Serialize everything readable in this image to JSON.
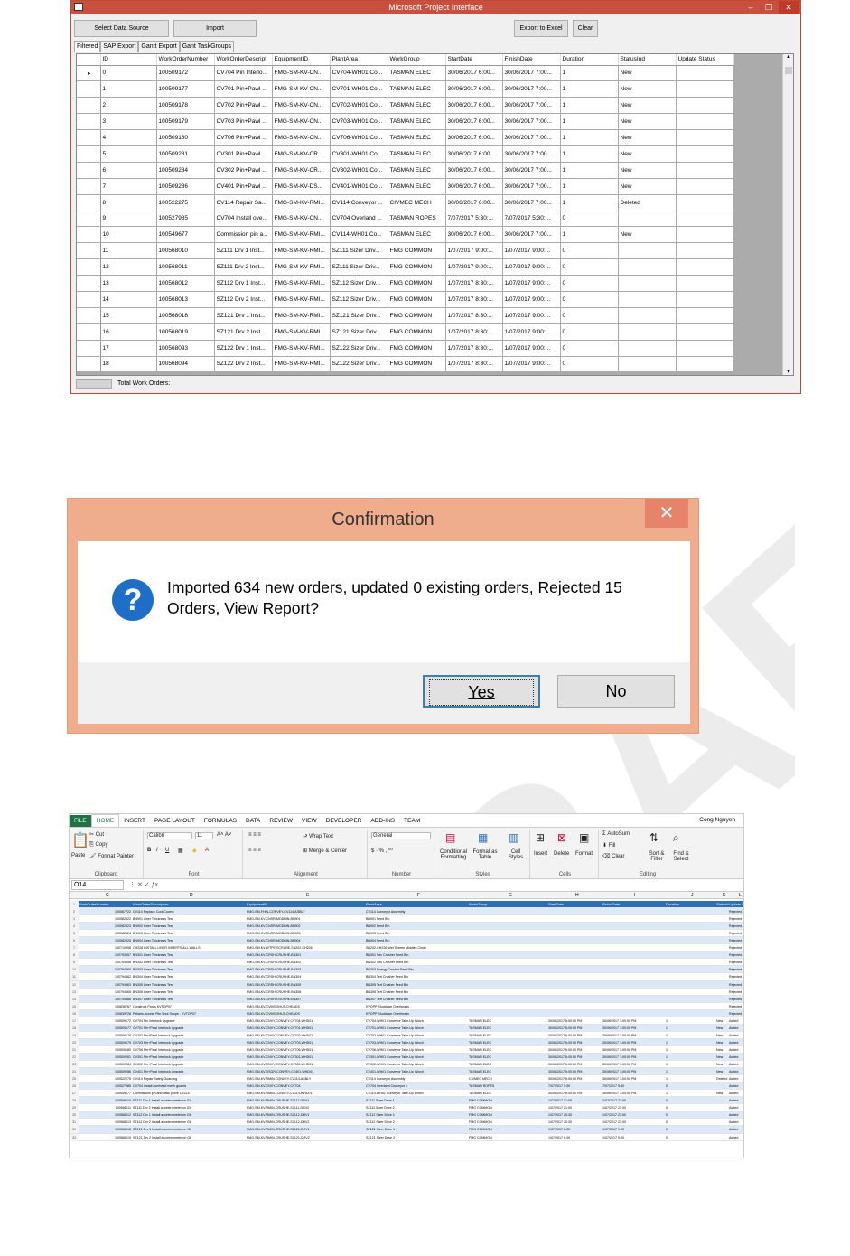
{
  "app_window": {
    "title": "Microsoft Project Interface",
    "buttons": {
      "select": "Select Data Source",
      "import": "Import",
      "export": "Export to Excel",
      "clear": "Clear"
    },
    "tabs": [
      "Filtered",
      "SAP Export",
      "Gantt Export",
      "Gant TaskGroups"
    ],
    "columns": [
      "ID",
      "WorkOrderNumber",
      "WorkOrderDescript",
      "EquipmentID",
      "PlantArea",
      "WorkGroup",
      "StartDate",
      "FinishDate",
      "Duration",
      "StatusInd",
      "Update Status"
    ],
    "rows": [
      [
        "0",
        "100509172",
        "CV704 Pin Interlo...",
        "FMG-SM-KV-CN...",
        "CV704-WH01 Co...",
        "TASMAN ELEC",
        "30/06/2017 6:00...",
        "30/06/2017 7:00...",
        "1",
        "New",
        ""
      ],
      [
        "1",
        "100509177",
        "CV701 Pin+Pawl ...",
        "FMG-SM-KV-CN...",
        "CV701-WH01 Co...",
        "TASMAN ELEC",
        "30/06/2017 6:00...",
        "30/06/2017 7:00...",
        "1",
        "New",
        ""
      ],
      [
        "2",
        "100509178",
        "CV702 Pin+Pawl ...",
        "FMG-SM-KV-CN...",
        "CV702-WH01 Co...",
        "TASMAN ELEC",
        "30/06/2017 6:00...",
        "30/06/2017 7:00...",
        "1",
        "New",
        ""
      ],
      [
        "3",
        "100509179",
        "CV703 Pin+Pawl ...",
        "FMG-SM-KV-CN...",
        "CV703-WH01 Co...",
        "TASMAN ELEC",
        "30/06/2017 6:00...",
        "30/06/2017 7:00...",
        "1",
        "New",
        ""
      ],
      [
        "4",
        "100509180",
        "CV706 Pin+Pawl ...",
        "FMG-SM-KV-CN...",
        "CV706-WH01 Co...",
        "TASMAN ELEC",
        "30/06/2017 6:00...",
        "30/06/2017 7:00...",
        "1",
        "New",
        ""
      ],
      [
        "5",
        "100509281",
        "CV301 Pin+Pawl ...",
        "FMG-SM-KV-CR...",
        "CV301-WH01 Co...",
        "TASMAN ELEC",
        "30/06/2017 6:00...",
        "30/06/2017 7:00...",
        "1",
        "New",
        ""
      ],
      [
        "6",
        "100509284",
        "CV302 Pin+Pawl ...",
        "FMG-SM-KV-CR...",
        "CV302-WH01 Co...",
        "TASMAN ELEC",
        "30/06/2017 6:00...",
        "30/06/2017 7:00...",
        "1",
        "New",
        ""
      ],
      [
        "7",
        "100509286",
        "CV401 Pin+Pawl ...",
        "FMG-SM-KV-DS...",
        "CV401-WH01 Co...",
        "TASMAN ELEC",
        "30/06/2017 6:00...",
        "30/06/2017 7:00...",
        "1",
        "New",
        ""
      ],
      [
        "8",
        "100522275",
        "CV114 Repair Sa...",
        "FMG-SM-KV-RMI...",
        "CV114 Conveyor ...",
        "CIVMEC MECH",
        "30/06/2017 6:00...",
        "30/06/2017 7:00...",
        "1",
        "Deleted",
        ""
      ],
      [
        "9",
        "100527985",
        "CV704 Install ove...",
        "FMG-SM-KV-CN...",
        "CV704 Overland ...",
        "TASMAN ROPES",
        "7/07/2017 5:30:...",
        "7/07/2017 5:30:...",
        "0",
        "",
        ""
      ],
      [
        "10",
        "100549677",
        "Commission pin a...",
        "FMG-SM-KV-RMI...",
        "CV114-WH01 Co...",
        "TASMAN ELEC",
        "30/06/2017 6:00...",
        "30/06/2017 7:00...",
        "1",
        "New",
        ""
      ],
      [
        "11",
        "100568010",
        "SZ111 Drv 1 Inst...",
        "FMG-SM-KV-RMI...",
        "SZ111 Sizer Driv...",
        "FMG COMMON",
        "1/07/2017 9:00:...",
        "1/07/2017 9:00:...",
        "0",
        "",
        ""
      ],
      [
        "12",
        "100568011",
        "SZ111 Drv 2 Inst...",
        "FMG-SM-KV-RMI...",
        "SZ111 Sizer Driv...",
        "FMG COMMON",
        "1/07/2017 9:00:...",
        "1/07/2017 9:00:...",
        "0",
        "",
        ""
      ],
      [
        "13",
        "100568012",
        "SZ112 Drv 1 Inst...",
        "FMG-SM-KV-RMI...",
        "SZ112 Sizer Driv...",
        "FMG COMMON",
        "1/07/2017 8:30:...",
        "1/07/2017 9:00:...",
        "0",
        "",
        ""
      ],
      [
        "14",
        "100568013",
        "SZ112 Drv 2 Inst...",
        "FMG-SM-KV-RMI...",
        "SZ112 Sizer Driv...",
        "FMG COMMON",
        "1/07/2017 8:30:...",
        "1/07/2017 9:00:...",
        "0",
        "",
        ""
      ],
      [
        "15",
        "100568018",
        "SZ121 Drv 1 Inst...",
        "FMG-SM-KV-RMI...",
        "SZ121 Sizer Driv...",
        "FMG COMMON",
        "1/07/2017 8:30:...",
        "1/07/2017 9:00:...",
        "0",
        "",
        ""
      ],
      [
        "16",
        "100568019",
        "SZ121 Drv 2 Inst...",
        "FMG-SM-KV-RMI...",
        "SZ121 Sizer Driv...",
        "FMG COMMON",
        "1/07/2017 8:30:...",
        "1/07/2017 9:00:...",
        "0",
        "",
        ""
      ],
      [
        "17",
        "100568093",
        "SZ122 Drv 1 Inst...",
        "FMG-SM-KV-RMI...",
        "SZ122 Sizer Driv...",
        "FMG COMMON",
        "1/07/2017 8:30:...",
        "1/07/2017 9:00:...",
        "0",
        "",
        ""
      ],
      [
        "18",
        "100568094",
        "SZ122 Drv 2 Inst...",
        "FMG-SM-KV-RMI...",
        "SZ122 Sizer Driv...",
        "FMG COMMON",
        "1/07/2017 8:30:...",
        "1/07/2017 9:00:...",
        "0",
        "",
        ""
      ]
    ],
    "status_label": "Total Work Orders:"
  },
  "dialog": {
    "title": "Confirmation",
    "close": "✕",
    "message": "Imported 634 new orders,  updated 0 existing orders, Rejected 15 Orders, View Report?",
    "yes": "Yes",
    "no": "No"
  },
  "excel": {
    "tabs": [
      "FILE",
      "HOME",
      "INSERT",
      "PAGE LAYOUT",
      "FORMULAS",
      "DATA",
      "REVIEW",
      "VIEW",
      "DEVELOPER",
      "ADD-INS",
      "TEAM"
    ],
    "user": "Cong Nguyen",
    "name_box": "O14",
    "groups": {
      "clipboard": "Clipboard",
      "font": "Font",
      "alignment": "Alignment",
      "number": "Number",
      "styles": "Styles",
      "cells": "Cells",
      "editing": "Editing"
    },
    "ribbon_items": {
      "paste": "Paste",
      "cut": "Cut",
      "copy": "Copy",
      "format_painter": "Format Painter",
      "font_name": "Calibri",
      "font_size": "11",
      "wrap": "Wrap Text",
      "merge": "Merge & Center",
      "number_format": "General",
      "cond": "Conditional Formatting",
      "format_table": "Format as Table",
      "cell_styles": "Cell Styles",
      "insert": "Insert",
      "delete": "Delete",
      "format": "Format",
      "autosum": "AutoSum",
      "fill": "Fill",
      "clear": "Clear",
      "sort": "Sort & Filter",
      "find": "Find & Select"
    },
    "col_letters": [
      "C",
      "D",
      "E",
      "F",
      "G",
      "H",
      "I",
      "J",
      "K",
      "L"
    ],
    "headers": [
      "WorkOrderNumber",
      "WorkOrderDescription",
      "EquipmentID",
      "PlantArea",
      "WorkGroup",
      "StartDate",
      "FinishDate",
      "Duration",
      "StatusInd",
      "Update S"
    ],
    "rows": [
      [
        "100567722",
        "CV114 Replace Cool Covers",
        "FMG-SM-FHIN-CONVEY-CV114-ASBLY",
        "CV114 Conveyor Assembly",
        "",
        "",
        "",
        "",
        "",
        "Rejected"
      ],
      [
        "100582522",
        "BN901 Liner Thickness Test",
        "FMG-SM-KV-CNSR-MODBIN-BN901",
        "BN901 Feed Bin",
        "",
        "",
        "",
        "",
        "",
        "Rejected"
      ],
      [
        "100582523",
        "BN902 Liner Thickness Test",
        "FMG-SM-KV-CNSR-MODBIN-BN902",
        "BN902 Feed Bin",
        "",
        "",
        "",
        "",
        "",
        "Rejected"
      ],
      [
        "100582524",
        "BN903 Liner Thickness Test",
        "FMG-SM-KV-CNSR-MODBIN-BN903",
        "BN903 Feed Bin",
        "",
        "",
        "",
        "",
        "",
        "Rejected"
      ],
      [
        "100582525",
        "BN904 Liner Thickness Test",
        "FMG-SM-KV-CNSR-MODBIN-BN904",
        "BN904 Feed Bin",
        "",
        "",
        "",
        "",
        "",
        "Rejected"
      ],
      [
        "100710998",
        "CH226 INSTALL LINER INSERTS ALL WALLS",
        "FMG-SM-KV-WTPE-SCRUBE-SN202-CH226",
        "SN202-CH226 Wet Screen Middles Chute",
        "",
        "",
        "",
        "",
        "",
        "Rejected"
      ],
      [
        "100793657",
        "BN301 Liner Thickness Test",
        "FMG-SM-KV-CRSH-CRUSHE-BN301",
        "BN301 Sec Crusher Feed Bin",
        "",
        "",
        "",
        "",
        "",
        "Rejected"
      ],
      [
        "100793658",
        "BN302 Liner Thickness Test",
        "FMG-SM-KV-CRSH-CRUSHE-BN302",
        "BN302 Sec Crusher Feed Bin",
        "",
        "",
        "",
        "",
        "",
        "Rejected"
      ],
      [
        "100794660",
        "BN303 Liner Thickness Test",
        "FMG-SM-KV-CRSH-CRUSHE-BN303",
        "BN303 Energy Crusher Feed Bin",
        "",
        "",
        "",
        "",
        "",
        "Rejected"
      ],
      [
        "100794662",
        "BN304 Liner Thickness Test",
        "FMG-SM-KV-CRSH-CRUSHE-BN304",
        "BN304 Tert Crusher Feed Bin",
        "",
        "",
        "",
        "",
        "",
        "Rejected"
      ],
      [
        "100794663",
        "BN305 Liner Thickness Test",
        "FMG-SM-KV-CRSH-CRUSHE-BN305",
        "BN305 Tert Crusher Feed Bin",
        "",
        "",
        "",
        "",
        "",
        "Rejected"
      ],
      [
        "100794665",
        "BN306 Liner Thickness Test",
        "FMG-SM-KV-CRSH-CRUSHE-BN306",
        "BN306 Tert Crusher Feed Bin",
        "",
        "",
        "",
        "",
        "",
        "Rejected"
      ],
      [
        "100794666",
        "BN307 Liner Thickness Test",
        "FMG-SM-KV-CRSH-CRUSHE-BN307",
        "BN307 Tert Crusher Feed Bin",
        "",
        "",
        "",
        "",
        "",
        "Rejected"
      ],
      [
        "100836767",
        "Construct Props KVTOP07",
        "FMG-SM-KV-CVMS-SHUT-CHEADS",
        "KVOPP Shutdown Overheads",
        "",
        "",
        "",
        "",
        "",
        "Rejected"
      ],
      [
        "100839728",
        "Pellaris Access Pile Shut Scope - KVTOP07",
        "FMG-SM-KV-CVMS-SHUT-CHEADS",
        "KVOPP Shutdown Overheads",
        "",
        "",
        "",
        "",
        "",
        "Rejected"
      ],
      [
        "100509172",
        "CV704 Pin Interlock Upgrade",
        "FMG-SM-KV-CNVY-CONVEY-CV704-WHD01",
        "CV704-WH01 Conveyor Take-Up Winch",
        "TASMAN ELEC",
        "30/06/2017 6:00:00 PM",
        "30/06/2017 7:00:00 PM",
        "1",
        "New",
        "Added"
      ],
      [
        "100509177",
        "CV701 Pin+Pawl Interlock Upgrade",
        "FMG-SM-KV-CNVY-CONVEY-CV701-WHD01",
        "CV701-WH01 Conveyor Take-Up Winch",
        "TASMAN ELEC",
        "30/06/2017 6:00:00 PM",
        "30/06/2017 7:00:00 PM",
        "1",
        "New",
        "Added"
      ],
      [
        "100509178",
        "CV702 Pin+Pawl Interlock Upgrade",
        "FMG-SM-KV-CNVY-CONVEY-CV702-WHD01",
        "CV702-WH01 Conveyor Take-Up Winch",
        "TASMAN ELEC",
        "30/06/2017 6:00:00 PM",
        "30/06/2017 7:00:00 PM",
        "1",
        "New",
        "Added"
      ],
      [
        "100509179",
        "CV703 Pin+Pawl Interlock Upgrade",
        "FMG-SM-KV-CNVY-CONVEY-CV703-WHD01",
        "CV703-WH01 Conveyor Take-Up Winch",
        "TASMAN ELEC",
        "30/06/2017 6:00:00 PM",
        "30/06/2017 7:00:00 PM",
        "1",
        "New",
        "Added"
      ],
      [
        "100509180",
        "CV706 Pin+Pawl Interlock Upgrade",
        "FMG-SM-KV-CNVY-CONVEY-CV706-WHD01",
        "CV706-WH01 Conveyor Take-Up Winch",
        "TASMAN ELEC",
        "30/06/2017 6:00:00 PM",
        "30/06/2017 7:00:00 PM",
        "1",
        "New",
        "Added"
      ],
      [
        "100509281",
        "CV301 Pin+Pawl Interlock Upgrade",
        "FMG-SM-KV-CNVY-CONVEY-CV301-WHD01",
        "CV301-WH01 Conveyor Take-Up Winch",
        "TASMAN ELEC",
        "30/06/2017 6:00:00 PM",
        "30/06/2017 7:00:00 PM",
        "1",
        "New",
        "Added"
      ],
      [
        "100509284",
        "CV302 Pin+Pawl Interlock Upgrade",
        "FMG-SM-KV-CNVY-CONVEY-CV302-WHD01",
        "CV302-WH01 Conveyor Take-Up Winch",
        "TASMAN ELEC",
        "30/06/2017 6:00:00 PM",
        "30/06/2017 7:00:00 PM",
        "1",
        "New",
        "Added"
      ],
      [
        "100509286",
        "CV401 Pin+Pawl Interlock Upgrade",
        "FMG-SM-KV-DSGR-CONVEY-CV401-WHD01",
        "CV401-WH01 Conveyor Take-Up Winch",
        "TASMAN ELEC",
        "30/06/2017 6:00:00 PM",
        "30/06/2017 7:00:00 PM",
        "1",
        "New",
        "Added"
      ],
      [
        "100522275",
        "CV114 Repair Safety Guarding",
        "FMG-SM-KV-RMIN-CONVEY-CV114-ASBLY",
        "CV114 Conveyor Assembly",
        "CIVMEC MECH",
        "30/06/2017 6:00:00 PM",
        "30/06/2017 7:00:00 PM",
        "1",
        "Deleted",
        "Added"
      ],
      [
        "100527985",
        "CV704 Install overhead mesh guards",
        "FMG-SM-KV-CNVY-CONVEY-CV704",
        "CV704 Overland Conveyor 1",
        "TASMAN ROPES",
        "7/07/2017 5:30",
        "7/07/2017 5:30",
        "0",
        "",
        "Added"
      ],
      [
        "100549677",
        "Commission pin and pawl prove CV114",
        "FMG-SM-KV-RMIN-CONVEY-CV114-WHD01",
        "CV114-WH01 Conveyor Take-Up Winch",
        "TASMAN ELEC",
        "30/06/2017 6:00:00 PM",
        "30/06/2017 7:00:00 PM",
        "1",
        "New",
        "Added"
      ],
      [
        "100568010",
        "SZ111 Drv 1 Install accelerometer on Gb",
        "FMG-SM-KV-RMIN-CRUSHE-SZ111-DRV1",
        "SZ111 Sizer Drive 1",
        "FMG COMMON",
        "1/07/2017 21:00",
        "1/07/2017 21:00",
        "0",
        "",
        "Added"
      ],
      [
        "100568011",
        "SZ111 Drv 2 Install accelerometer on Gb",
        "FMG-SM-KV-RMIN-CRUSHE-SZ111-DRV2",
        "SZ111 Sizer Drive 2",
        "FMG COMMON",
        "1/07/2017 21:00",
        "1/07/2017 21:00",
        "0",
        "",
        "Added"
      ],
      [
        "100568012",
        "SZ112 Drv 1 Install accelerometer on Gb",
        "FMG-SM-KV-RMIN-CRUSHE-SZ112-DRV1",
        "SZ112 Sizer Drive 1",
        "FMG COMMON",
        "1/07/2017 20:30",
        "1/07/2017 21:00",
        "0",
        "",
        "Added"
      ],
      [
        "100568013",
        "SZ112 Drv 2 Install accelerometer on Gb",
        "FMG-SM-KV-RMIN-CRUSHE-SZ112-DRV2",
        "SZ112 Sizer Drive 2",
        "FMG COMMON",
        "1/07/2017 20:30",
        "1/07/2017 21:00",
        "0",
        "",
        "Added"
      ],
      [
        "100568018",
        "SZ121 Drv 1 Install accelerometer on Gb",
        "FMG-SM-KV-RMIN-CRUSHE-SZ121-DRV1",
        "SZ121 Sizer Drive 1",
        "FMG COMMON",
        "1/07/2017 8:30",
        "1/07/2017 9:00",
        "0",
        "",
        "Added"
      ],
      [
        "100568019",
        "SZ121 Drv 2 Install accelerometer on Gb",
        "FMG-SM-KV-RMIN-CRUSHE-SZ121-DRV2",
        "SZ121 Sizer Drive 2",
        "FMG COMMON",
        "1/07/2017 8:30",
        "1/07/2017 9:00",
        "0",
        "",
        "Added"
      ]
    ]
  },
  "watermark": "DRAFT",
  "colors": {
    "title_bar": "#c9503f",
    "dialog_frame": "#f0ad8d",
    "excel_green": "#217346",
    "excel_header": "#2d6fb5",
    "watermark": "#e8e8e8"
  }
}
